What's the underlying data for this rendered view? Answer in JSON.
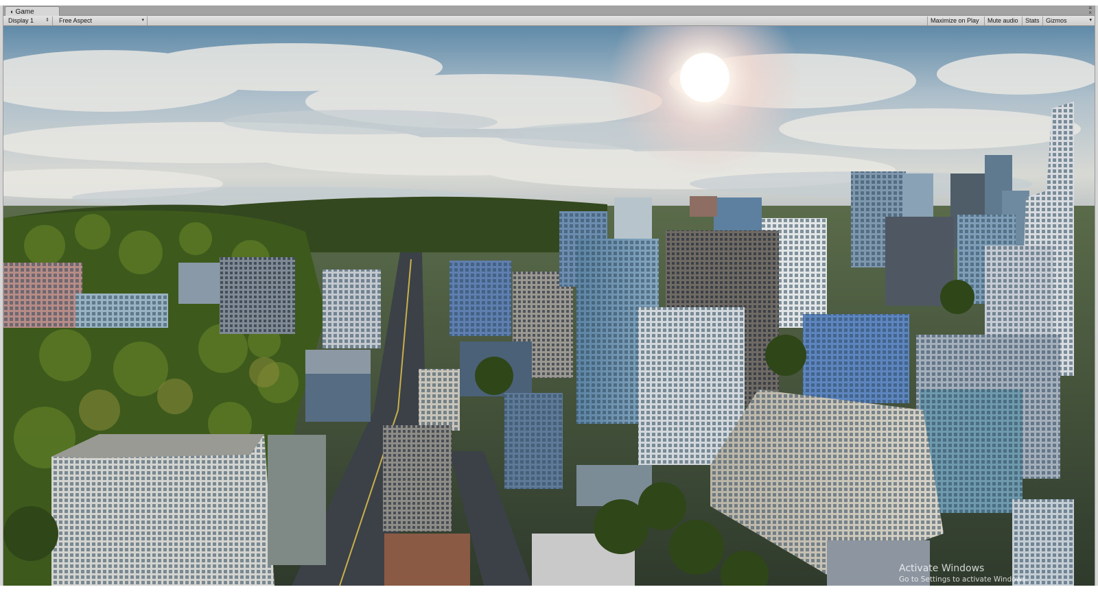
{
  "window": {
    "tab_label": "Game",
    "tab_icon": "pacman-icon",
    "controls": [
      "≡",
      "×"
    ]
  },
  "toolbar": {
    "display": "Display 1",
    "aspect": "Free Aspect",
    "maximize_on_play": "Maximize on Play",
    "mute_audio": "Mute audio",
    "stats": "Stats",
    "gizmos": "Gizmos"
  },
  "overlay": {
    "activate_title": "Activate Windows",
    "activate_subtitle": "Go to Settings to activate Windows."
  },
  "colors": {
    "sky_top": "#6f94ad",
    "cloud": "#e6e6e2",
    "trees": "#3e5a1e",
    "road": "#3a3f44",
    "building_light": "#c9c6bd",
    "building_glass": "#6e93b0"
  }
}
